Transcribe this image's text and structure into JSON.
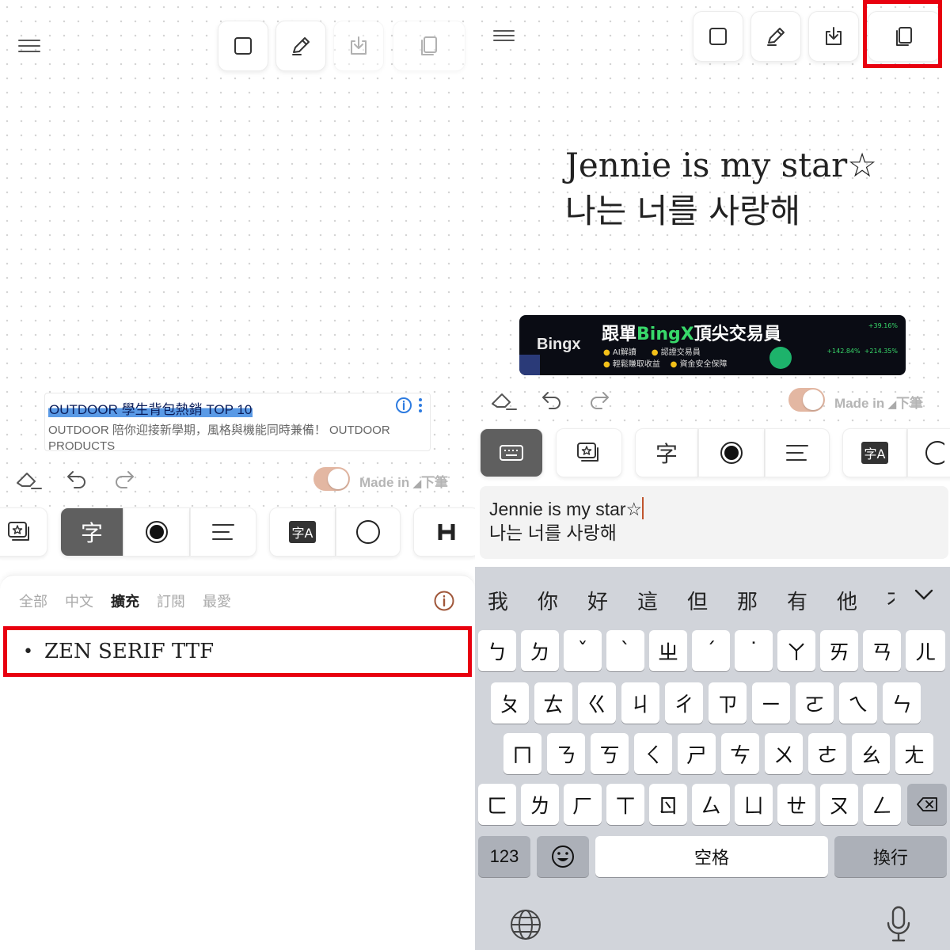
{
  "left": {
    "ad": {
      "title": "OUTDOOR 學生背包熱銷 TOP 10",
      "description": "OUTDOOR 陪你迎接新學期，風格與機能同時兼備！ OUTDOOR PRODUCTS"
    },
    "made_in": "Made in",
    "made_in_brand": "下筆",
    "tool_icons": [
      "sticker-icon",
      "font-icon",
      "color-icon",
      "align-icon",
      "translate-icon",
      "shape-icon",
      "heading-icon"
    ],
    "tool_labels": {
      "font": "字",
      "translate": "字A"
    },
    "tabs": [
      {
        "label": "全部"
      },
      {
        "label": "中文"
      },
      {
        "label": "擴充"
      },
      {
        "label": "訂閱"
      },
      {
        "label": "最愛"
      }
    ],
    "active_tab": "擴充",
    "font_item": "ZEN SERIF TTF",
    "bullet": "•"
  },
  "right": {
    "preview": {
      "line1": "Jennie is my star☆",
      "line2": "나는 너를 사랑해"
    },
    "banner": {
      "brand": "Bingx",
      "headline_pre": "跟單",
      "headline_brand": "BingX",
      "headline_post": "頂尖交易員",
      "features": [
        "AI解讀",
        "認證交易員",
        "輕鬆賺取收益",
        "資金安全保障"
      ],
      "stats": [
        "+39.16%",
        "+142.84%",
        "+214.35%"
      ]
    },
    "made_in": "Made in",
    "made_in_brand": "下筆",
    "tool_labels": {
      "font": "字",
      "translate": "字A"
    },
    "input": {
      "line1": "Jennie is my star☆",
      "line2": "나는 너를 사랑해"
    },
    "keyboard": {
      "candidates": [
        "我",
        "你",
        "好",
        "這",
        "但",
        "那",
        "有",
        "他",
        "不"
      ],
      "row1": [
        "ㄅ",
        "ㄉ",
        "ˇ",
        "ˋ",
        "ㄓ",
        "ˊ",
        "˙",
        "ㄚ",
        "ㄞ",
        "ㄢ",
        "ㄦ"
      ],
      "row2": [
        "ㄆ",
        "ㄊ",
        "ㄍ",
        "ㄐ",
        "ㄔ",
        "ㄗ",
        "ㄧ",
        "ㄛ",
        "ㄟ",
        "ㄣ"
      ],
      "row3": [
        "ㄇ",
        "ㄋ",
        "ㄎ",
        "ㄑ",
        "ㄕ",
        "ㄘ",
        "ㄨ",
        "ㄜ",
        "ㄠ",
        "ㄤ"
      ],
      "row4": [
        "ㄈ",
        "ㄌ",
        "ㄏ",
        "ㄒ",
        "ㄖ",
        "ㄙ",
        "ㄩ",
        "ㄝ",
        "ㄡ",
        "ㄥ"
      ],
      "num_key": "123",
      "space_key": "空格",
      "return_key": "換行"
    }
  },
  "colors": {
    "highlight_red": "#e8000f",
    "toggle_on": "#e3b7a2",
    "keyboard_bg": "#d1d4da"
  }
}
